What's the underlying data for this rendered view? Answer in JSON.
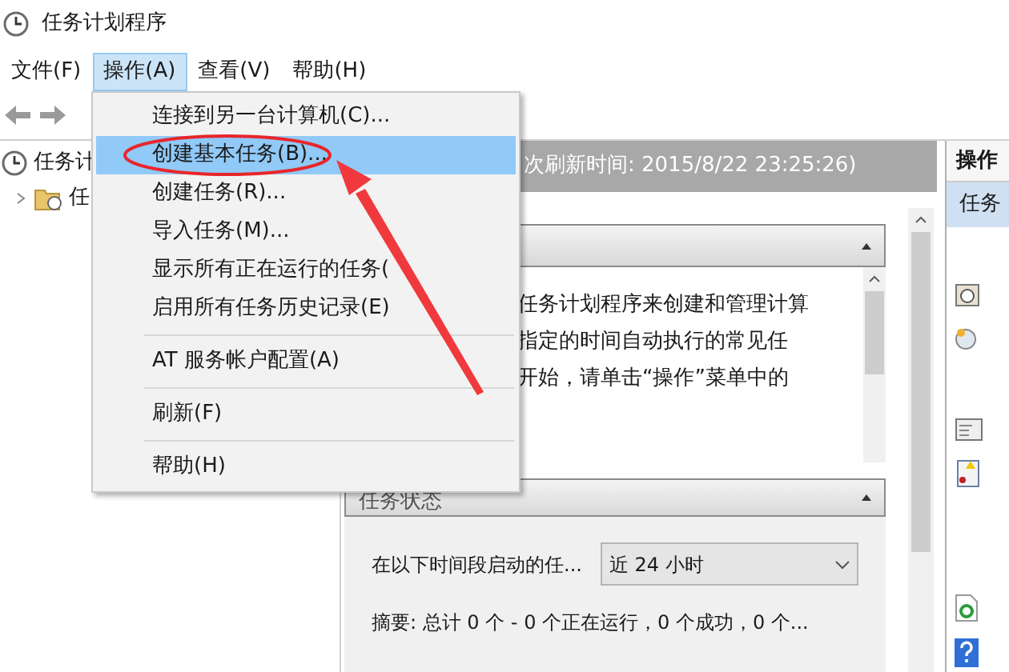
{
  "window": {
    "title": "任务计划程序"
  },
  "menubar": [
    {
      "label": "文件(F)",
      "selected": false
    },
    {
      "label": "操作(A)",
      "selected": true
    },
    {
      "label": "查看(V)",
      "selected": false
    },
    {
      "label": "帮助(H)",
      "selected": false
    }
  ],
  "dropdown": [
    {
      "kind": "item",
      "label": "连接到另一台计算机(C)...",
      "selected": false
    },
    {
      "kind": "item",
      "label": "创建基本任务(B)...",
      "selected": true
    },
    {
      "kind": "item",
      "label": "创建任务(R)...",
      "selected": false
    },
    {
      "kind": "item",
      "label": "导入任务(M)...",
      "selected": false
    },
    {
      "kind": "item",
      "label": "显示所有正在运行的任务(",
      "selected": false
    },
    {
      "kind": "item",
      "label": "启用所有任务历史记录(E)",
      "selected": false
    },
    {
      "kind": "separator"
    },
    {
      "kind": "item",
      "label": "AT 服务帐户配置(A)",
      "selected": false
    },
    {
      "kind": "separator"
    },
    {
      "kind": "item",
      "label": "刷新(F)",
      "selected": false
    },
    {
      "kind": "separator"
    },
    {
      "kind": "item",
      "label": "帮助(H)",
      "selected": false
    }
  ],
  "tree": [
    {
      "label": "任务计",
      "children": [
        {
          "label": "任",
          "expanded": false
        }
      ]
    }
  ],
  "center": {
    "refresh": "次刷新时间: 2015/8/22 23:25:26)",
    "overview_lines": [
      "任务计划程序来创建和管理计算",
      "指定的时间自动执行的常见任",
      "开始，请单击“操作”菜单中的"
    ],
    "status": {
      "title": "任务状态",
      "period_label": "在以下时间段启动的任...",
      "period": "近 24 小时",
      "summary": "摘要: 总计 0 个 - 0 个正在运行，0 个成功，0 个..."
    }
  },
  "actions": {
    "title": "操作",
    "section": "任务"
  }
}
